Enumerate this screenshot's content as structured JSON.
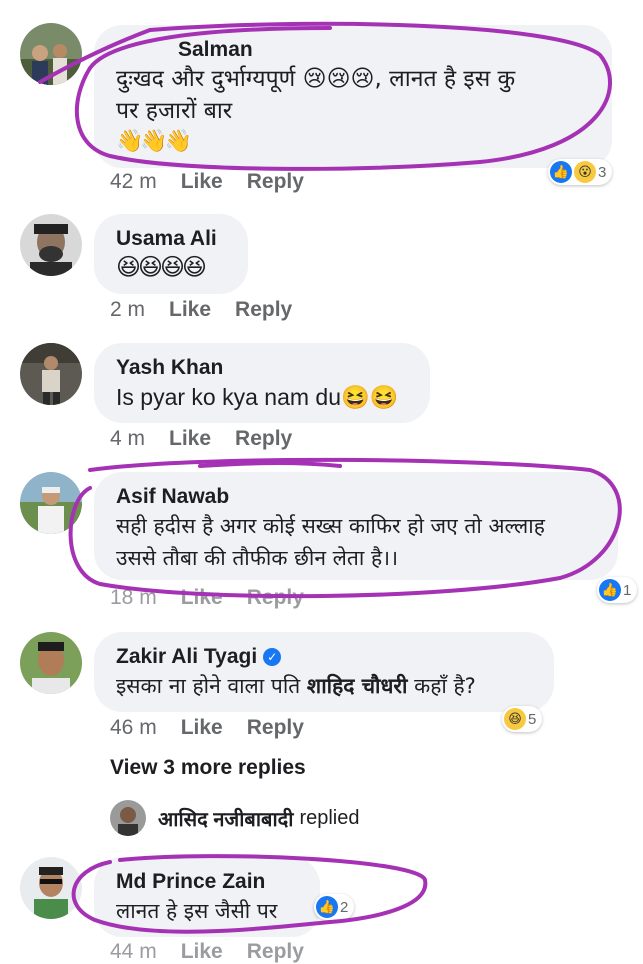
{
  "comments": [
    {
      "name": "Salman",
      "text_line1": "दुःखद और दुर्भाग्यपूर्ण 😢😢😢, लानत है इस कु",
      "text_line2": "पर हजारों बार",
      "text_line3": "👋👋👋",
      "time": "42 m",
      "like": "Like",
      "reply": "Reply",
      "reaction_count": "3"
    },
    {
      "name": "Usama Ali",
      "text_line1": "😆😆😆😆",
      "time": "2 m",
      "like": "Like",
      "reply": "Reply"
    },
    {
      "name": "Yash Khan",
      "text_line1": "Is pyar ko kya nam du😆😆",
      "time": "4 m",
      "like": "Like",
      "reply": "Reply"
    },
    {
      "name": "Asif Nawab",
      "text_line1": "सही हदीस है अगर कोई सख्स काफिर हो जए तो अल्लाह",
      "text_line2": "उससे तौबा की तौफीक छीन लेता है।।",
      "time": "18 m",
      "like": "Like",
      "reply": "Reply",
      "reaction_count": "1"
    },
    {
      "name": "Zakir Ali Tyagi",
      "text_pre": "इसका ना होने वाला पति ",
      "text_bold": "शाहिद चौधरी",
      "text_post": " कहाँ है?",
      "time": "46 m",
      "like": "Like",
      "reply": "Reply",
      "reaction_count": "5"
    },
    {
      "name": "Md Prince Zain",
      "text_line1": "लानत हे इस जैसी पर",
      "time": "44 m",
      "like": "Like",
      "reply": "Reply",
      "reaction_count": "2"
    }
  ],
  "view_more": "View 3 more replies",
  "replied": {
    "name": "आसिद नजीबाबादी",
    "label": "replied"
  },
  "colors": {
    "bubble": "#f0f2f5",
    "meta": "#65676b",
    "like_blue": "#1877f2",
    "annotation": "#a531b5"
  },
  "icons": [
    "like-icon",
    "wow-icon",
    "haha-icon",
    "verified-badge-icon"
  ]
}
